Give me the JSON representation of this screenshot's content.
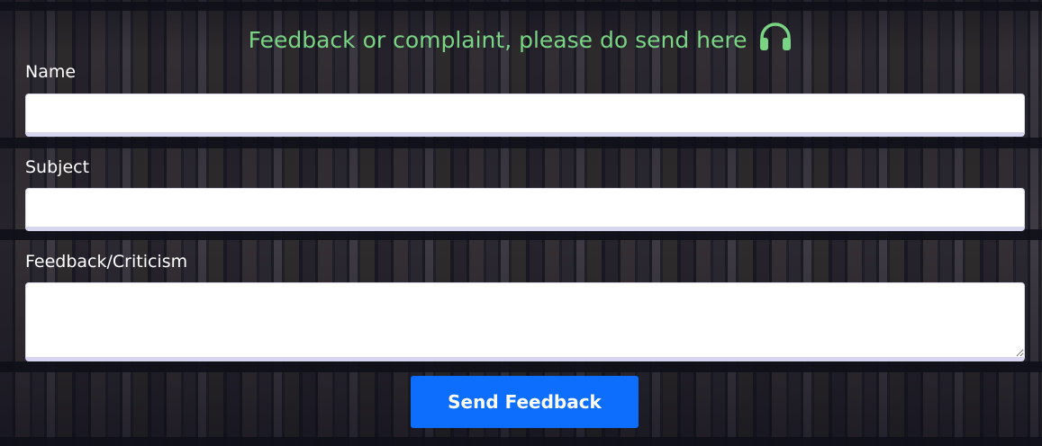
{
  "heading": {
    "text": "Feedback or complaint, please do send here",
    "icon": "headphones-icon"
  },
  "fields": {
    "name": {
      "label": "Name",
      "value": "",
      "placeholder": ""
    },
    "subject": {
      "label": "Subject",
      "value": "",
      "placeholder": ""
    },
    "feedback": {
      "label": "Feedback/Criticism",
      "value": "",
      "placeholder": ""
    }
  },
  "submit": {
    "label": "Send Feedback"
  },
  "colors": {
    "heading": "#79d483",
    "button": "#0d6efd",
    "label": "#ffffff",
    "background": "#15161f"
  }
}
